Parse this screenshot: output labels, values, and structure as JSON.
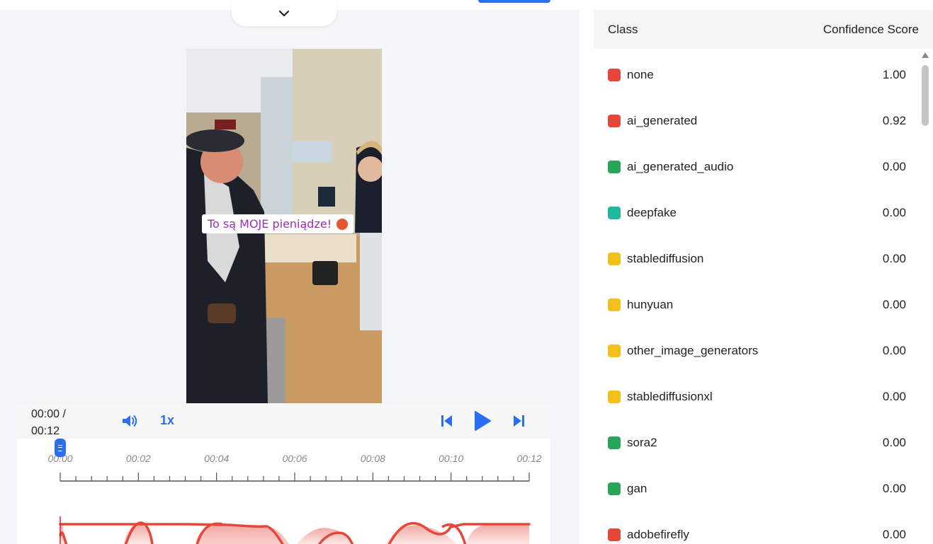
{
  "player": {
    "caption": "To są MOJE pieniądze!",
    "current_time": "00:00 /",
    "duration": "00:12",
    "speed": "1x",
    "timeline_ticks": [
      "00:00",
      "00:02",
      "00:04",
      "00:06",
      "00:08",
      "00:10",
      "00:12"
    ],
    "playhead_fraction": 0.0
  },
  "results": {
    "header_class": "Class",
    "header_score": "Confidence Score",
    "rows": [
      {
        "label": "none",
        "score": "1.00",
        "color": "#e5483b"
      },
      {
        "label": "ai_generated",
        "score": "0.92",
        "color": "#e5483b"
      },
      {
        "label": "ai_generated_audio",
        "score": "0.00",
        "color": "#27a65a"
      },
      {
        "label": "deepfake",
        "score": "0.00",
        "color": "#1fb89a"
      },
      {
        "label": "stablediffusion",
        "score": "0.00",
        "color": "#f2c01b"
      },
      {
        "label": "hunyuan",
        "score": "0.00",
        "color": "#f2c01b"
      },
      {
        "label": "other_image_generators",
        "score": "0.00",
        "color": "#f2c01b"
      },
      {
        "label": "stablediffusionxl",
        "score": "0.00",
        "color": "#f2c01b"
      },
      {
        "label": "sora2",
        "score": "0.00",
        "color": "#27a65a"
      },
      {
        "label": "gan",
        "score": "0.00",
        "color": "#27a65a"
      },
      {
        "label": "adobefirefly",
        "score": "0.00",
        "color": "#e5483b"
      }
    ]
  },
  "colors": {
    "accent": "#2a6ff2",
    "curve": "#e5483b"
  }
}
